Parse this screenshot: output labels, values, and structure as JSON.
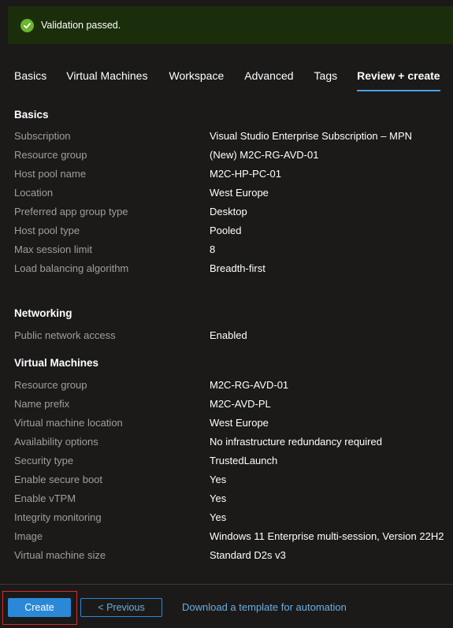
{
  "banner": {
    "text": "Validation passed."
  },
  "tabs": [
    {
      "label": "Basics"
    },
    {
      "label": "Virtual Machines"
    },
    {
      "label": "Workspace"
    },
    {
      "label": "Advanced"
    },
    {
      "label": "Tags"
    },
    {
      "label": "Review + create"
    }
  ],
  "basics": {
    "title": "Basics",
    "rows": [
      {
        "label": "Subscription",
        "value": "Visual Studio Enterprise Subscription – MPN"
      },
      {
        "label": "Resource group",
        "value": "(New) M2C-RG-AVD-01"
      },
      {
        "label": "Host pool name",
        "value": "M2C-HP-PC-01"
      },
      {
        "label": "Location",
        "value": "West Europe"
      },
      {
        "label": "Preferred app group type",
        "value": "Desktop"
      },
      {
        "label": "Host pool type",
        "value": "Pooled"
      },
      {
        "label": "Max session limit",
        "value": "8"
      },
      {
        "label": "Load balancing algorithm",
        "value": "Breadth-first"
      }
    ]
  },
  "networking": {
    "title": "Networking",
    "rows": [
      {
        "label": "Public network access",
        "value": "Enabled"
      }
    ]
  },
  "virtual_machines": {
    "title": "Virtual Machines",
    "rows": [
      {
        "label": "Resource group",
        "value": "M2C-RG-AVD-01"
      },
      {
        "label": "Name prefix",
        "value": "M2C-AVD-PL"
      },
      {
        "label": "Virtual machine location",
        "value": "West Europe"
      },
      {
        "label": "Availability options",
        "value": "No infrastructure redundancy required"
      },
      {
        "label": "Security type",
        "value": "TrustedLaunch"
      },
      {
        "label": "Enable secure boot",
        "value": "Yes"
      },
      {
        "label": "Enable vTPM",
        "value": "Yes"
      },
      {
        "label": "Integrity monitoring",
        "value": "Yes"
      },
      {
        "label": "Image",
        "value": "Windows 11 Enterprise multi-session, Version 22H2"
      },
      {
        "label": "Virtual machine size",
        "value": "Standard D2s v3"
      }
    ]
  },
  "footer": {
    "create_label": "Create",
    "previous_label": "< Previous",
    "download_label": "Download a template for automation"
  },
  "colors": {
    "banner_bg": "#1b2e0c",
    "success_green": "#6ab62e",
    "accent_blue": "#2b88d8",
    "link_blue": "#69afe5",
    "highlight_red": "#d12f2f"
  },
  "icons": {
    "banner": "checkmark-circle-icon"
  }
}
